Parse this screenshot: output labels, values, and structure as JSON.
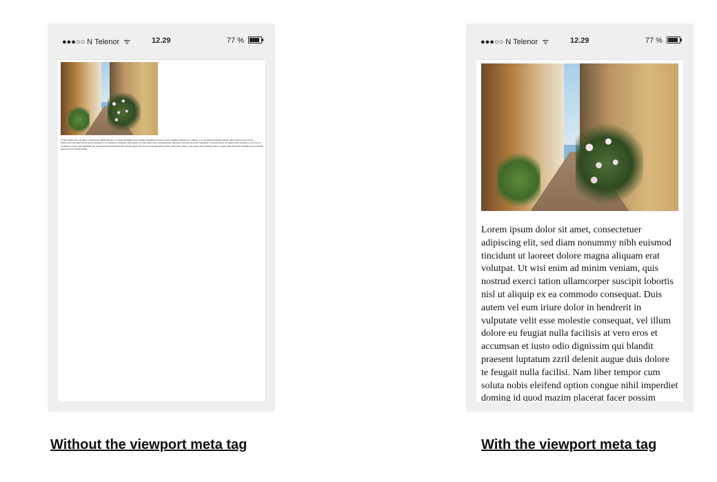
{
  "statusbar": {
    "carrier": "●●●○○ N Telenor",
    "wifi_icon": "wifi-icon",
    "time": "12.29",
    "battery": "77 %",
    "battery_level": 0.77
  },
  "lorem_text": "Lorem ipsum dolor sit amet, consectetuer adipiscing elit, sed diam nonummy nibh euismod tincidunt ut laoreet dolore magna aliquam erat volutpat. Ut wisi enim ad minim veniam, quis nostrud exerci tation ullamcorper suscipit lobortis nisl ut aliquip ex ea commodo consequat. Duis autem vel eum iriure dolor in hendrerit in vulputate velit esse molestie consequat, vel illum dolore eu feugiat nulla facilisis at vero eros et accumsan et iusto odio dignissim qui blandit praesent luptatum zzril delenit augue duis dolore te feugait nulla facilisi. Nam liber tempor cum soluta nobis eleifend option congue nihil imperdiet doming id quod mazim placerat facer possim assum.",
  "captions": {
    "without": "Without the viewport meta tag",
    "with": "With the viewport meta tag"
  }
}
